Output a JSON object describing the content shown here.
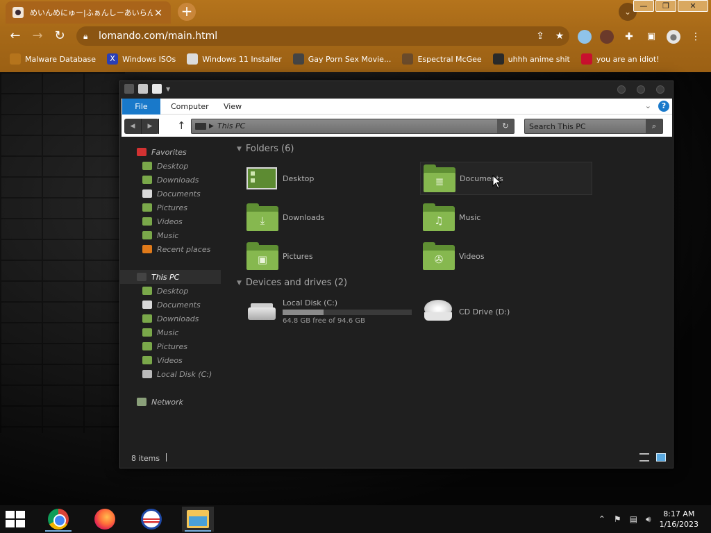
{
  "browser": {
    "tab_title": "めいんめにゅー|ふぁんしーあいらんど",
    "tab_close": "×",
    "new_tab": "+",
    "tab_search": "⌄",
    "window_controls": {
      "minimize": "—",
      "restore": "❐",
      "close": "✕"
    },
    "url": "lomando.com/main.html",
    "nav": {
      "back": "←",
      "forward": "→",
      "reload": "↻"
    },
    "bookmarks": [
      {
        "label": "Malware Database",
        "icon": "bookmark-malware-icon",
        "color": "#b5741c",
        "glyph": ""
      },
      {
        "label": "Windows ISOs",
        "icon": "bookmark-x-icon",
        "color": "#2a3fb5",
        "glyph": "X"
      },
      {
        "label": "Windows 11 Installer",
        "icon": "bookmark-installer-icon",
        "color": "#dcdcdc",
        "glyph": ""
      },
      {
        "label": "Gay Porn Sex Movie...",
        "icon": "bookmark-film-icon",
        "color": "#444444",
        "glyph": ""
      },
      {
        "label": "Espectral McGee",
        "icon": "bookmark-face-icon",
        "color": "#6a4a2a",
        "glyph": ""
      },
      {
        "label": "uhhh anime shit",
        "icon": "bookmark-anime-icon",
        "color": "#2a2a2a",
        "glyph": ""
      },
      {
        "label": "you are an idiot!",
        "icon": "bookmark-uk-flag-icon",
        "color": "#c8102e",
        "glyph": ""
      }
    ],
    "theme_color": "#a86a18"
  },
  "explorer": {
    "ribbon_tabs": {
      "file": "File",
      "computer": "Computer",
      "view": "View"
    },
    "help": "?",
    "breadcrumb": "This PC",
    "search_placeholder": "Search This PC",
    "nav": {
      "favorites_header": "Favorites",
      "favorites": [
        "Desktop",
        "Downloads",
        "Documents",
        "Pictures",
        "Videos",
        "Music",
        "Recent places"
      ],
      "this_pc_header": "This PC",
      "this_pc": [
        "Desktop",
        "Documents",
        "Downloads",
        "Music",
        "Pictures",
        "Videos",
        "Local Disk (C:)"
      ],
      "network": "Network"
    },
    "folders_section": "Folders (6)",
    "folders": [
      {
        "name": "Desktop",
        "icon": "desktop-folder-icon"
      },
      {
        "name": "Documents",
        "icon": "documents-folder-icon"
      },
      {
        "name": "Downloads",
        "icon": "downloads-folder-icon"
      },
      {
        "name": "Music",
        "icon": "music-folder-icon"
      },
      {
        "name": "Pictures",
        "icon": "pictures-folder-icon"
      },
      {
        "name": "Videos",
        "icon": "videos-folder-icon"
      }
    ],
    "drives_section": "Devices and drives (2)",
    "drives": [
      {
        "name": "Local Disk (C:)",
        "free_text": "64.8 GB free of 94.6 GB",
        "used_fraction": 0.315
      },
      {
        "name": "CD Drive (D:)"
      }
    ],
    "status": "8 items",
    "accent_color": "#1979ca",
    "folder_color": "#86b84f"
  },
  "taskbar": {
    "apps": [
      "Google Chrome",
      "Firefox",
      "Obama",
      "File Explorer"
    ],
    "time": "8:17 AM",
    "date": "1/16/2023"
  }
}
